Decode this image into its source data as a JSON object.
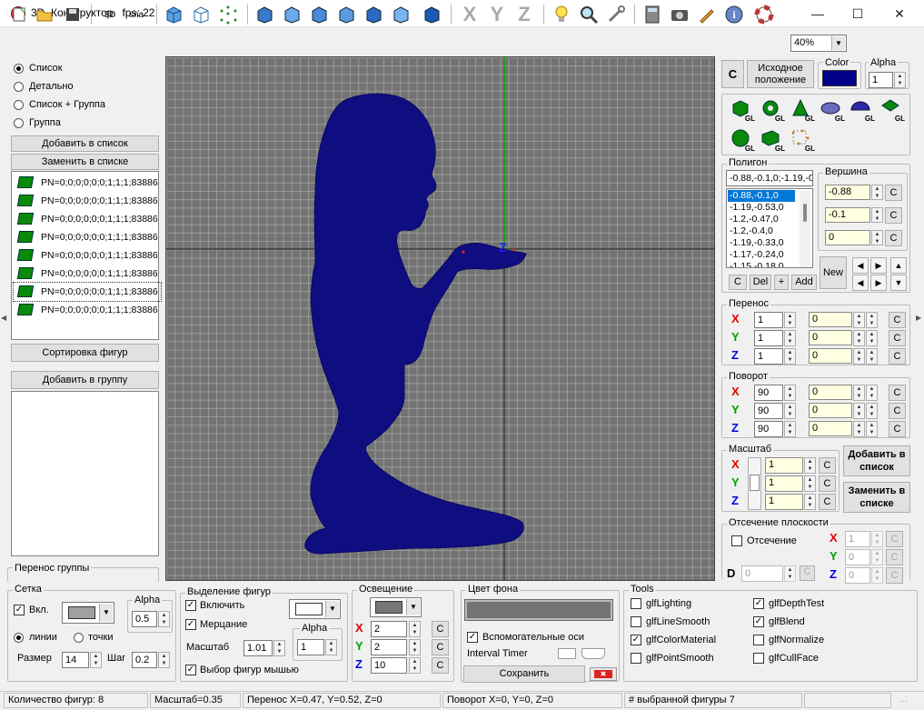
{
  "window": {
    "title": "3D_Конструктор",
    "fps": "fps: 22"
  },
  "toolbar": {
    "zoom": "40%",
    "axis_x": "X",
    "axis_y": "Y",
    "axis_z": "Z",
    "sna": "sna",
    "label_3d": "3D"
  },
  "left": {
    "view_modes": [
      "Список",
      "Детально",
      "Список + Группа",
      "Группа"
    ],
    "view_selected": 0,
    "add_to_list": "Добавить в список",
    "replace_in_list": "Заменить в списке",
    "items": [
      "PN=0;0;0;0;0;0;1;1;1;83886",
      "PN=0;0;0;0;0;0;1;1;1;83886",
      "PN=0;0;0;0;0;0;1;1;1;83886",
      "PN=0;0;0;0;0;0;1;1;1;83886",
      "PN=0;0;0;0;0;0;1;1;1;83886",
      "PN=0;0;0;0;0;0;1;1;1;83886",
      "PN=0;0;0;0;0;0;1;1;1;83886",
      "PN=0;0;0;0;0;0;1;1;1;83886"
    ],
    "sort_shapes": "Сортировка фигур",
    "add_to_group": "Добавить в группу",
    "group_move": "Перенос группы"
  },
  "viewport": {
    "axis_label": "Z",
    "figure_color": "#0e0e80",
    "bg_color": "#737373"
  },
  "right": {
    "c_button": "C",
    "initial_position": "Исходное положение",
    "color_label": "Color",
    "color_value": "#00008b",
    "alpha_label": "Alpha",
    "alpha_value": "1",
    "gl_label": "GL",
    "polygon": {
      "title": "Полигон",
      "field": "-0.88,-0.1,0;-1.19,-0",
      "items": [
        "-0.88,-0.1,0",
        "-1.19,-0.53,0",
        "-1.2,-0.47,0",
        "-1.2,-0.4,0",
        "-1.19,-0.33,0",
        "-1.17,-0.24,0",
        "-1.15,-0.18,0"
      ],
      "c": "C",
      "del": "Del",
      "plus": "+",
      "add": "Add",
      "new": "New"
    },
    "vertex": {
      "title": "Вершина",
      "values": [
        "-0.88",
        "-0.1",
        "0"
      ]
    },
    "translate": {
      "title": "Перенос",
      "rows": [
        {
          "axis": "X",
          "v1": "1",
          "v2": "0"
        },
        {
          "axis": "Y",
          "v1": "1",
          "v2": "0"
        },
        {
          "axis": "Z",
          "v1": "1",
          "v2": "0"
        }
      ]
    },
    "rotate": {
      "title": "Поворот",
      "rows": [
        {
          "axis": "X",
          "v1": "90",
          "v2": "0"
        },
        {
          "axis": "Y",
          "v1": "90",
          "v2": "0"
        },
        {
          "axis": "Z",
          "v1": "90",
          "v2": "0"
        }
      ]
    },
    "scale": {
      "title": "Масштаб",
      "rows": [
        {
          "axis": "X",
          "v": "1"
        },
        {
          "axis": "Y",
          "v": "1"
        },
        {
          "axis": "Z",
          "v": "1"
        }
      ],
      "add": "Добавить в список",
      "replace": "Заменить в списке"
    },
    "clip": {
      "title": "Отсечение плоскости",
      "check": "Отсечение",
      "d_label": "D",
      "d_value": "0",
      "rows": [
        {
          "axis": "X",
          "v": "1"
        },
        {
          "axis": "Y",
          "v": "0"
        },
        {
          "axis": "Z",
          "v": "0"
        }
      ]
    }
  },
  "bottom": {
    "grid": {
      "title": "Сетка",
      "enable": "Вкл.",
      "alpha_label": "Alpha",
      "alpha": "0.5",
      "lines": "линии",
      "points": "точки",
      "size_label": "Размер",
      "size": "14",
      "step_label": "Шаг",
      "step": "0.2"
    },
    "selection": {
      "title": "Выделение фигур",
      "enable": "Включить",
      "blink": "Мерцание",
      "scale_label": "Масштаб",
      "scale": "1.01",
      "alpha_label": "Alpha",
      "alpha": "1",
      "mouse": "Выбор фигур мышью"
    },
    "light": {
      "title": "Освещение",
      "rows": [
        {
          "axis": "X",
          "v": "2"
        },
        {
          "axis": "Y",
          "v": "2"
        },
        {
          "axis": "Z",
          "v": "10"
        }
      ]
    },
    "bg": {
      "title": "Цвет фона",
      "aux_axes": "Вспомогательные оси",
      "interval": "Interval Timer",
      "save": "Сохранить"
    },
    "tools": {
      "title": "Tools",
      "col1": [
        {
          "label": "glfLighting",
          "on": false
        },
        {
          "label": "glfLineSmooth",
          "on": false
        },
        {
          "label": "glfColorMaterial",
          "on": true
        },
        {
          "label": "glfPointSmooth",
          "on": false
        }
      ],
      "col2": [
        {
          "label": "glfDepthTest",
          "on": true
        },
        {
          "label": "glfBlend",
          "on": true
        },
        {
          "label": "glfNormalize",
          "on": false
        },
        {
          "label": "glfCullFace",
          "on": false
        }
      ]
    }
  },
  "status": {
    "count": "Количество фигур: 8",
    "scale": "Масштаб=0.35",
    "move": "Перенос X=0.47, Y=0.52, Z=0",
    "rot": "Поворот X=0, Y=0, Z=0",
    "sel": "# выбранной фигуры 7"
  }
}
